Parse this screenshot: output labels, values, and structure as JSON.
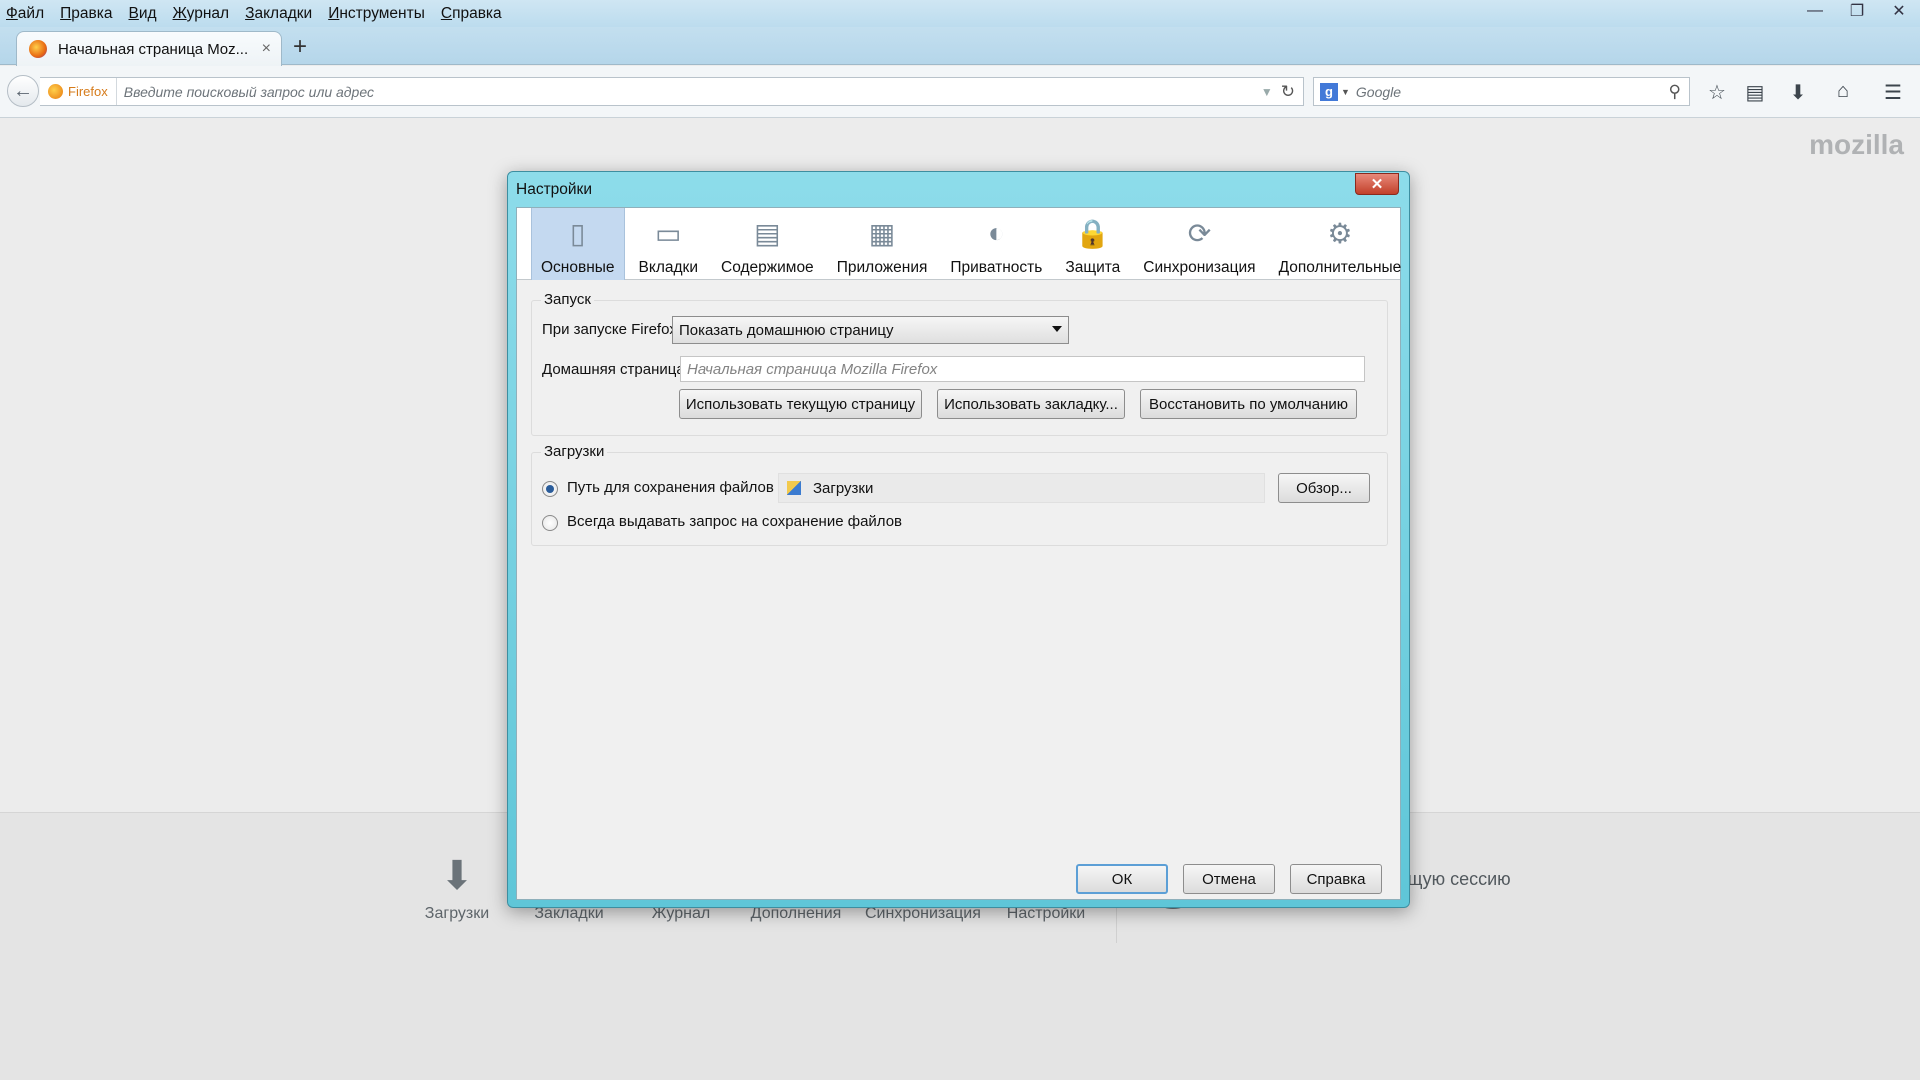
{
  "menubar": {
    "items": [
      "Файл",
      "Правка",
      "Вид",
      "Журнал",
      "Закладки",
      "Инструменты",
      "Справка"
    ]
  },
  "window_controls": {
    "minimize": "—",
    "restore": "❐",
    "close": "✕"
  },
  "tabs": [
    {
      "title": "Начальная страница Moz...",
      "close": "×"
    }
  ],
  "new_tab": "+",
  "navbar": {
    "back": "←",
    "identity_label": "Firefox",
    "url_placeholder": "Введите поисковый запрос или адрес",
    "search_engine": "g",
    "search_placeholder": "Google",
    "icons": [
      "star-icon",
      "bookmarks-menu-icon",
      "downloads-icon",
      "home-icon",
      "menu-icon"
    ]
  },
  "page": {
    "brand": "mozilla"
  },
  "launcher": {
    "items": [
      {
        "label": "Загрузки",
        "glyph": "⬇"
      },
      {
        "label": "Закладки",
        "glyph": "★"
      },
      {
        "label": "Журнал",
        "glyph": "🕒"
      },
      {
        "label": "Дополнения",
        "glyph": "✚"
      },
      {
        "label": "Синхронизация",
        "glyph": "⟳"
      },
      {
        "label": "Настройки",
        "glyph": "⚙"
      }
    ],
    "restore_label": "Восстановить предыдущую сессию",
    "restore_glyph": "↻"
  },
  "dialog": {
    "title": "Настройки",
    "close": "✕",
    "panes": [
      {
        "label": "Основные",
        "glyph": "▯",
        "selected": true
      },
      {
        "label": "Вкладки",
        "glyph": "▭"
      },
      {
        "label": "Содержимое",
        "glyph": "▤"
      },
      {
        "label": "Приложения",
        "glyph": "▦"
      },
      {
        "label": "Приватность",
        "glyph": "◐"
      },
      {
        "label": "Защита",
        "glyph": "🔒"
      },
      {
        "label": "Синхронизация",
        "glyph": "⟳"
      },
      {
        "label": "Дополнительные",
        "glyph": "⚙"
      }
    ],
    "startup": {
      "caption": "Запуск",
      "on_start_label": "При запуске Firefox:",
      "on_start_value": "Показать домашнюю страницу",
      "homepage_label": "Домашняя страница:",
      "homepage_placeholder": "Начальная страница Mozilla Firefox",
      "btn_current": "Использовать текущую страницу",
      "btn_bookmark": "Использовать закладку...",
      "btn_restore": "Восстановить по умолчанию"
    },
    "downloads": {
      "caption": "Загрузки",
      "radio_path_label": "Путь для сохранения файлов",
      "path_value": "Загрузки",
      "browse": "Обзор...",
      "radio_ask_label": "Всегда выдавать запрос на сохранение файлов"
    },
    "buttons": {
      "ok": "ОК",
      "cancel": "Отмена",
      "help": "Справка"
    }
  }
}
